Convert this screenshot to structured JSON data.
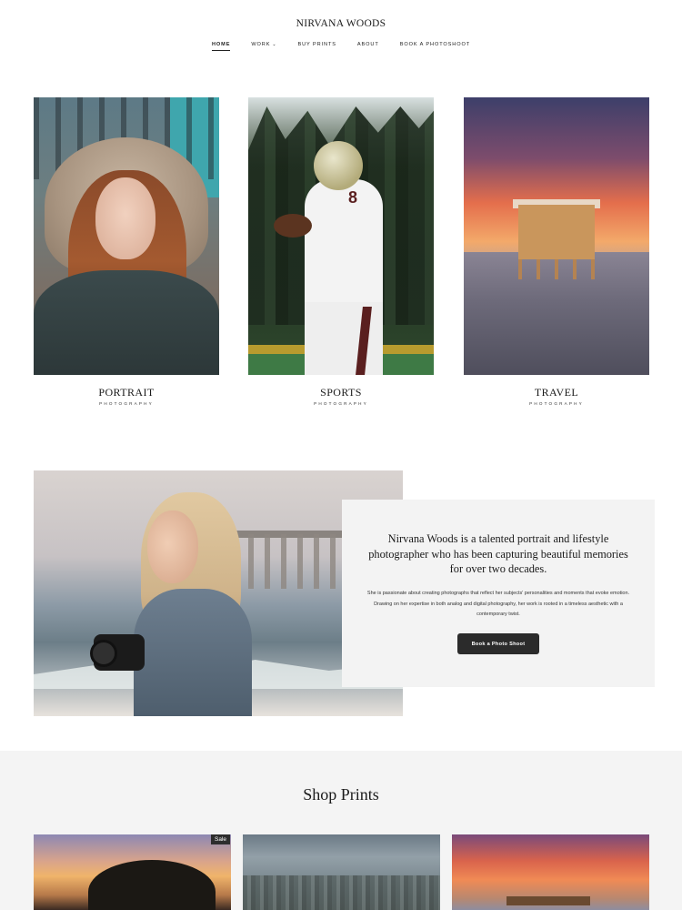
{
  "header": {
    "site_title": "NIRVANA WOODS",
    "nav": [
      {
        "label": "HOME",
        "active": true
      },
      {
        "label": "WORK",
        "has_dropdown": true
      },
      {
        "label": "BUY PRINTS"
      },
      {
        "label": "ABOUT"
      },
      {
        "label": "BOOK A PHOTOSHOOT"
      }
    ],
    "dropdown_icon": "chevron-down-icon"
  },
  "categories": [
    {
      "title": "PORTRAIT",
      "subtitle": "PHOTOGRAPHY"
    },
    {
      "title": "SPORTS",
      "subtitle": "PHOTOGRAPHY"
    },
    {
      "title": "TRAVEL",
      "subtitle": "PHOTOGRAPHY"
    }
  ],
  "about": {
    "heading": "Nirvana Woods is a talented portrait and lifestyle photographer who has been capturing beautiful memories for over two decades.",
    "body": "She is passionate about creating photographs that reflect her subjects' personalities and moments that evoke emotion. Drawing on her expertise in both analog and digital photography, her work is rooted in a timeless aesthetic with a contemporary twist.",
    "button_label": "Book a Photo Shoot"
  },
  "shop": {
    "title": "Shop Prints",
    "items": [
      {
        "badge": "Sale"
      },
      {},
      {}
    ]
  },
  "colors": {
    "text": "#1c1c1c",
    "button_bg": "#2b2b2b",
    "panel_bg": "#f3f3f3",
    "shop_bg": "#f4f4f4"
  }
}
